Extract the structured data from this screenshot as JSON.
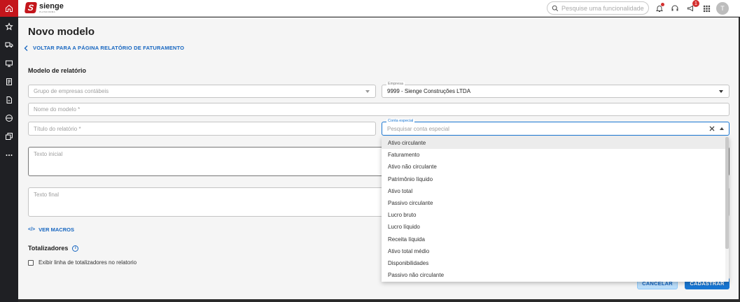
{
  "app": {
    "brand": "sienge",
    "brand_sub": "PLATAFORMA"
  },
  "search": {
    "placeholder": "Pesquise uma funcionalidade..."
  },
  "notifications": {
    "badge": "1"
  },
  "user": {
    "initial": "T"
  },
  "page": {
    "title": "Novo modelo",
    "back_label": "VOLTAR PARA A PÁGINA RELATÓRIO DE FATURAMENTO",
    "section_title": "Modelo de relatório"
  },
  "form": {
    "grupo_placeholder": "Grupo de empresas contábeis",
    "empresa_label": "Empresa",
    "empresa_value": "9999 - Sienge Construções LTDA",
    "nome_placeholder": "Nome do modelo *",
    "titulo_placeholder": "Título do relatório *",
    "conta_label": "Conta especial",
    "conta_placeholder": "Pesquisar conta especial",
    "texto_inicial_placeholder": "Texto inicial",
    "texto_final_placeholder": "Texto final",
    "macros_label": "VER MACROS",
    "totalizadores_title": "Totalizadores",
    "totalizadores_checkbox": "Exibir linha de totalizadores no relatorio"
  },
  "dropdown": {
    "options": [
      "Ativo circulante",
      "Faturamento",
      "Ativo não circulante",
      "Patrimônio líquido",
      "Ativo total",
      "Passivo circulante",
      "Lucro bruto",
      "Lucro líquido",
      "Receita líquida",
      "Ativo total médio",
      "Disponibilidades",
      "Passivo não circulante"
    ]
  },
  "buttons": {
    "cancel": "CANCELAR",
    "submit": "CADASTRAR"
  },
  "colors": {
    "brand": "#c4161c",
    "accent": "#1976d2"
  }
}
